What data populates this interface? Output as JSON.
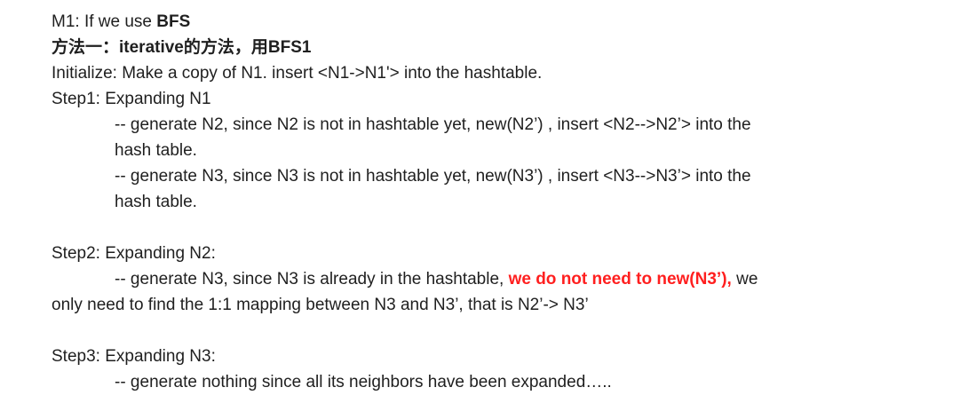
{
  "lines": {
    "l1_prefix": "M1: If we use ",
    "l1_bold": "BFS",
    "l2_heading": "方法一：iterative的方法，用BFS1",
    "l3": "Initialize: Make a copy of N1. insert <N1->N1'> into the hashtable.",
    "l4": "Step1:  Expanding N1",
    "l5": "-- generate N2, since N2 is not in hashtable yet,   new(N2’) , insert <N2-->N2’> into the",
    "l6": "hash table.",
    "l7": "-- generate N3, since N3 is not in hashtable yet,   new(N3’) , insert <N3-->N3’> into the",
    "l8": "hash table.",
    "l9": "Step2:  Expanding N2:",
    "l10_prefix": "-- generate N3, since N3 is already in the hashtable, ",
    "l10_red": "we do not need to new(N3’),",
    "l10_suffix": " we",
    "l11": "only need to find the 1:1 mapping between N3 and N3’,   that is   N2’-> N3’",
    "l12": "Step3:  Expanding N3:",
    "l13": "-- generate nothing since all its neighbors have been expanded….."
  },
  "colors": {
    "text": "#1f1f1f",
    "highlight_red": "#ff1f1f"
  }
}
